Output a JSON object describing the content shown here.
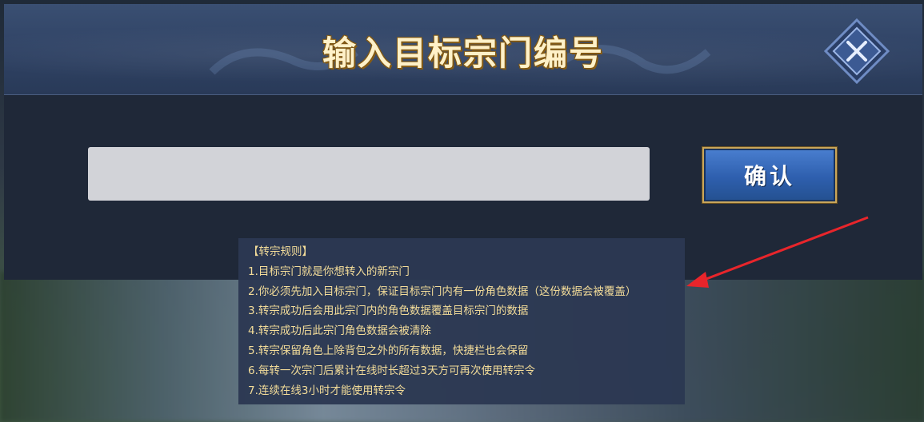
{
  "dialog": {
    "title": "输入目标宗门编号",
    "input": {
      "value": "",
      "placeholder": ""
    },
    "confirm_label": "确认",
    "close_icon": "close-x-icon"
  },
  "rules": {
    "heading": "【转宗规则】",
    "items": [
      "1.目标宗门就是你想转入的新宗门",
      "2.你必须先加入目标宗门，保证目标宗门内有一份角色数据（这份数据会被覆盖）",
      "3.转宗成功后会用此宗门内的角色数据覆盖目标宗门的数据",
      "4.转宗成功后此宗门角色数据会被清除",
      "5.转宗保留角色上除背包之外的所有数据，快捷栏也会保留",
      "6.每转一次宗门后累计在线时长超过3天方可再次使用转宗令",
      "7.连续在线3小时才能使用转宗令"
    ]
  },
  "colors": {
    "title_text": "#fff1c8",
    "rule_text": "#f3dc99",
    "confirm_bg": "#2e5fae",
    "annotation_arrow": "#e8252b"
  }
}
